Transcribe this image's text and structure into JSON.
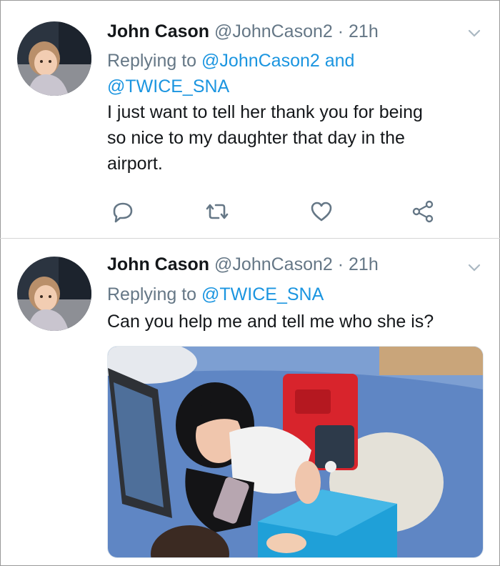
{
  "tweets": [
    {
      "name": "John Cason",
      "handle": "@JohnCason2",
      "separator": "·",
      "time": "21h",
      "replying_prefix": "Replying to",
      "mention_1": "@JohnCason2",
      "joiner": "and",
      "mention_2": "@TWICE_SNA",
      "text_line_1": "I just want to tell her thank you for being",
      "text_line_2": "so nice to my daughter that day in the",
      "text_line_3": "airport.",
      "action_icons": [
        "reply-icon",
        "retweet-icon",
        "like-icon",
        "share-icon"
      ]
    },
    {
      "name": "John Cason",
      "handle": "@JohnCason2",
      "separator": "·",
      "time": "21h",
      "replying_prefix": "Replying to",
      "mention_1": "@TWICE_SNA",
      "text_line_1": "Can you help me and tell me who she is?",
      "media": "photo-attachment"
    }
  ],
  "colors": {
    "name": "#14171a",
    "muted": "#657786",
    "mention": "#1b95e0",
    "divider": "#d6d6d6"
  }
}
